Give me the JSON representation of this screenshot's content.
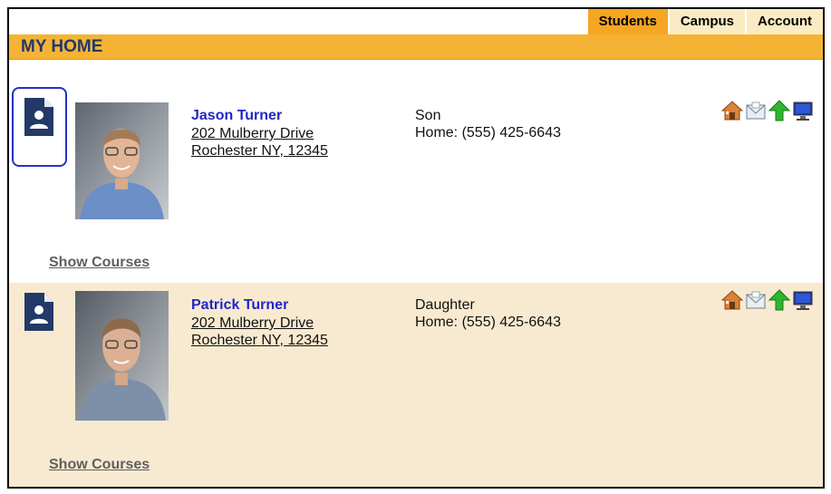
{
  "tabs": [
    "Students",
    "Campus",
    "Account"
  ],
  "active_tab": "Students",
  "page_title": "MY HOME",
  "students": [
    {
      "name": "Jason Turner",
      "address_line1": "202 Mulberry Drive",
      "address_line2": "Rochester NY, 12345",
      "relationship": "Son",
      "phone": "Home: (555) 425-6643",
      "show_courses": "Show Courses"
    },
    {
      "name": "Patrick Turner",
      "address_line1": "202 Mulberry Drive",
      "address_line2": "Rochester NY, 12345",
      "relationship": "Daughter",
      "phone": "Home: (555) 425-6643",
      "show_courses": "Show Courses"
    }
  ],
  "row_icons": [
    "house-icon",
    "envelope-icon",
    "green-up-arrow-icon",
    "computer-monitor-icon"
  ],
  "colors": {
    "accent_orange": "#f5b335",
    "title_navy": "#233a68",
    "link_blue": "#2127c5",
    "alt_row": "#f8ead0"
  }
}
